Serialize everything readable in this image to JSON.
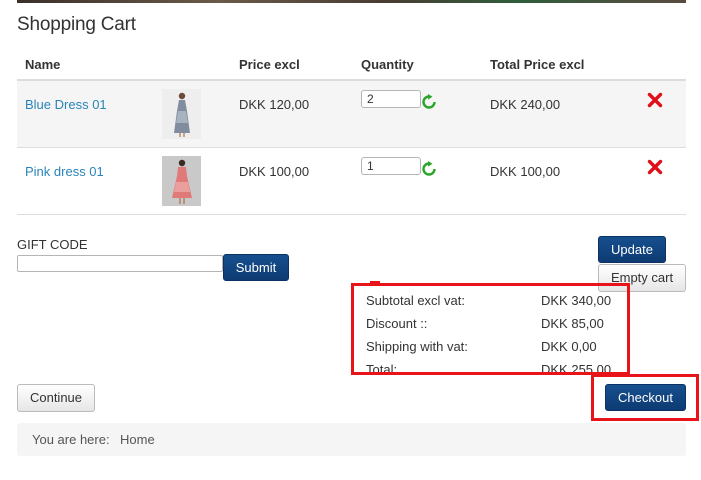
{
  "page": {
    "title": "Shopping Cart"
  },
  "table": {
    "headers": {
      "name": "Name",
      "price": "Price excl",
      "quantity": "Quantity",
      "total": "Total Price excl"
    },
    "rows": [
      {
        "name": "Blue Dress 01",
        "price": "DKK 120,00",
        "quantity": "2",
        "total": "DKK 240,00",
        "thumb_colors": [
          "#7f8d9e",
          "#b9c3cf"
        ]
      },
      {
        "name": "Pink dress 01",
        "price": "DKK 100,00",
        "quantity": "1",
        "total": "DKK 100,00",
        "thumb_colors": [
          "#e07a78",
          "#f1b8b5"
        ]
      }
    ]
  },
  "icons": {
    "refresh": "refresh-icon",
    "remove": "remove-icon"
  },
  "gift": {
    "label": "GIFT CODE",
    "value": "",
    "submit_label": "Submit"
  },
  "actions": {
    "update_label": "Update",
    "empty_cart_label": "Empty cart",
    "continue_label": "Continue",
    "checkout_label": "Checkout"
  },
  "summary": {
    "rows": [
      {
        "label": "Subtotal excl vat:",
        "value": "DKK 340,00"
      },
      {
        "label": "Discount ::",
        "value": "DKK 85,00"
      },
      {
        "label": "Shipping with vat:",
        "value": "DKK 0,00"
      },
      {
        "label": "Total:",
        "value": "DKK 255,00"
      }
    ]
  },
  "breadcrumb": {
    "label": "You are here:",
    "home": "Home"
  },
  "colors": {
    "link": "#2a84b8",
    "primary_button": "#0d3b72",
    "highlight": "#e8141a",
    "refresh": "#2aa52a",
    "remove": "#e0101a"
  }
}
